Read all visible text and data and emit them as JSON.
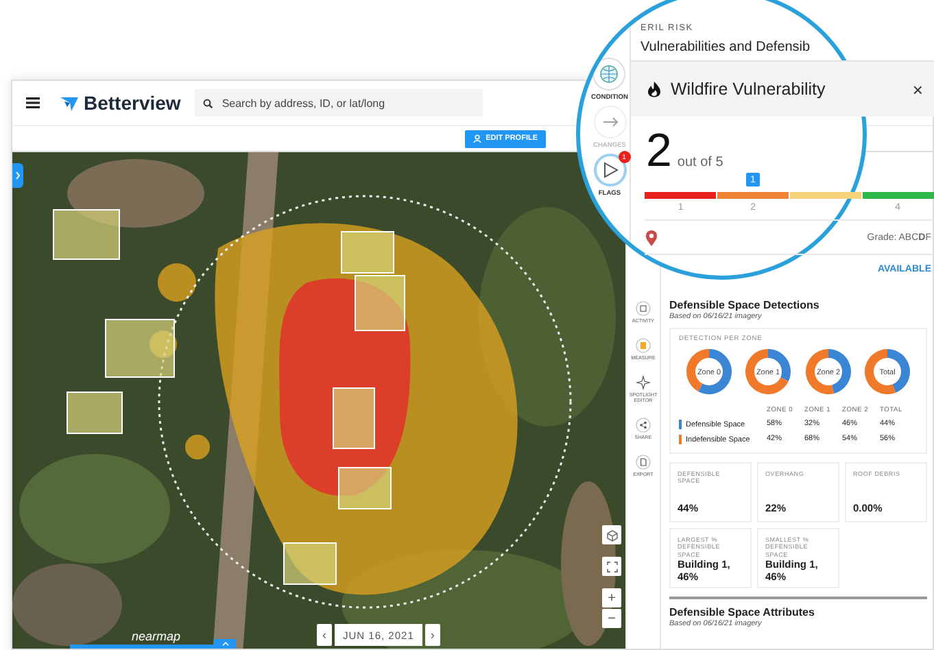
{
  "header": {
    "logo": "Betterview",
    "search": {
      "placeholder": "Search by address, ID, or lat/long"
    }
  },
  "toolbar": {
    "button": "EDIT PROFILE"
  },
  "map": {
    "attribution": "nearmap",
    "date": {
      "prev": "‹",
      "label": "JUN 16, 2021",
      "next": "›"
    },
    "zoom": {
      "in": "+",
      "out": "−"
    }
  },
  "side_rail": {
    "items": [
      {
        "label": "ACTIVITY"
      },
      {
        "label": "MEASURE"
      },
      {
        "label": "SPOTLIGHT EDITOR"
      },
      {
        "label": "SHARE"
      },
      {
        "label": "EXPORT"
      }
    ]
  },
  "magnifier": {
    "rail": [
      {
        "label": "CONDITION",
        "selected": false,
        "disabled": false
      },
      {
        "label": "CHANGES",
        "selected": false,
        "disabled": true
      },
      {
        "label": "FLAGS",
        "selected": true,
        "disabled": false,
        "badge": "1"
      }
    ],
    "section": "ERIL RISK",
    "title": "Vulnerabilities and Defensib",
    "card": {
      "title": "Wildfire Vulnerability",
      "close": "×",
      "score": "2",
      "score_note": "out of 5",
      "scale": [
        {
          "label": "1",
          "color": "#e8231e"
        },
        {
          "label": "2",
          "color": "#f08333",
          "marker": "1"
        },
        {
          "color": "#f6d27a"
        },
        {
          "label": "4",
          "color": "#2fb84a"
        }
      ],
      "grade": "Grade: ABC**D**F",
      "status": "AVAILABLE"
    }
  },
  "detections": {
    "title": "Defensible Space Detections",
    "subtitle": "Based on 06/16/21 imagery",
    "card_title": "DETECTION PER ZONE",
    "donuts": [
      {
        "chart_data": {
          "type": "donut",
          "series": [
            {
              "name": "Zone 0",
              "values": [
                58,
                42
              ]
            }
          ]
        }
      },
      {
        "chart_data": {
          "type": "donut",
          "series": [
            {
              "name": "Zone 1",
              "values": [
                32,
                68
              ]
            }
          ]
        }
      },
      {
        "chart_data": {
          "type": "donut",
          "series": [
            {
              "name": "Zone 2",
              "values": [
                46,
                54
              ]
            }
          ]
        }
      },
      {
        "chart_data": {
          "type": "donut",
          "series": [
            {
              "name": "Total",
              "values": [
                44,
                56
              ]
            }
          ]
        }
      }
    ],
    "table": {
      "columns": [
        "ZONE 0",
        "ZONE 1",
        "ZONE 2",
        "TOTAL"
      ],
      "rows": [
        {
          "label": "Defensible Space",
          "color": "#3a86d4",
          "cells": [
            "58%",
            "32%",
            "46%",
            "44%"
          ]
        },
        {
          "label": "Indefensible Space",
          "color": "#f07a2a",
          "cells": [
            "42%",
            "68%",
            "54%",
            "56%"
          ]
        }
      ]
    }
  },
  "metrics": [
    {
      "label": "DEFENSIBLE SPACE",
      "value": "44%"
    },
    {
      "label": "OVERHANG",
      "value": "22%"
    },
    {
      "label": "ROOF DEBRIS",
      "value": "0.00%"
    },
    {
      "label": "LARGEST % DEFENSIBLE SPACE",
      "value": "Building 1, 46%"
    },
    {
      "label": "SMALLEST % DEFENSIBLE SPACE",
      "value": "Building 1, 46%"
    }
  ],
  "attributes": {
    "title": "Defensible Space Attributes",
    "subtitle": "Based on 06/16/21 imagery"
  }
}
